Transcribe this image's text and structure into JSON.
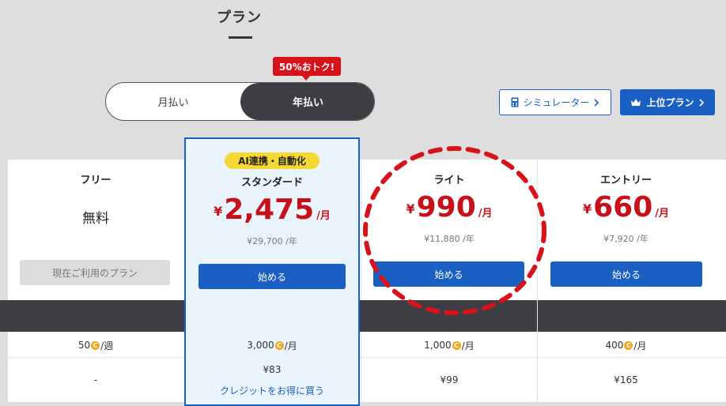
{
  "header": {
    "title": "プラン"
  },
  "billing_toggle": {
    "monthly_label": "月払い",
    "yearly_label": "年払い",
    "selected": "yearly"
  },
  "discount_badge": "50%おトク!",
  "simulator_button": {
    "label": "シミュレーター",
    "icon": "calculator-icon"
  },
  "upgrade_button": {
    "label": "上位プラン",
    "icon": "crown-icon"
  },
  "plans": [
    {
      "name": "フリー",
      "price_text": "無料",
      "button_label": "現在ご利用のプラン",
      "button_enabled": false,
      "credits": "50",
      "credits_unit": "/週",
      "credit_price": "-"
    },
    {
      "name": "スタンダード",
      "tag": "AI連携・自動化",
      "currency": "¥",
      "price": "2,475",
      "unit": "/月",
      "yearly": "¥29,700 /年",
      "button_label": "始める",
      "credits": "3,000",
      "credits_unit": "/月",
      "credit_price": "¥83",
      "credit_link": "クレジットをお得に買う",
      "highlighted": true
    },
    {
      "name": "ライト",
      "currency": "¥",
      "price": "990",
      "unit": "/月",
      "yearly": "¥11,880 /年",
      "button_label": "始める",
      "credits": "1,000",
      "credits_unit": "/月",
      "credit_price": "¥99"
    },
    {
      "name": "エントリー",
      "currency": "¥",
      "price": "660",
      "unit": "/月",
      "yearly": "¥7,920 /年",
      "button_label": "始める",
      "credits": "400",
      "credits_unit": "/月",
      "credit_price": "¥165"
    }
  ],
  "colors": {
    "accent_blue": "#1a5fc4",
    "price_red": "#c8101b",
    "badge_red": "#d8121b",
    "tag_yellow": "#f6d835",
    "toggle_dark": "#3d3e44",
    "coin": "#f2a81c"
  }
}
